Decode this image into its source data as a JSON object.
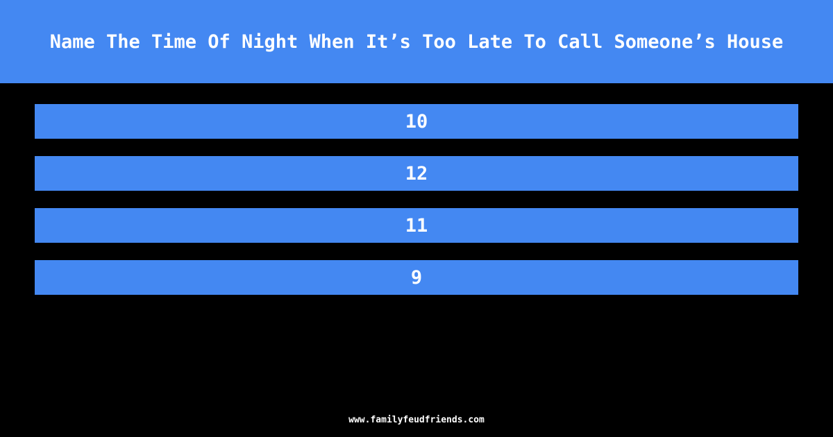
{
  "header": {
    "title": "Name The Time Of Night When It’s Too Late To Call Someone’s House"
  },
  "answers": [
    {
      "text": "10"
    },
    {
      "text": "12"
    },
    {
      "text": "11"
    },
    {
      "text": "9"
    }
  ],
  "footer": {
    "url": "www.familyfeudfriends.com"
  },
  "colors": {
    "accent": "#4488f2",
    "background": "#000000",
    "text": "#ffffff"
  }
}
